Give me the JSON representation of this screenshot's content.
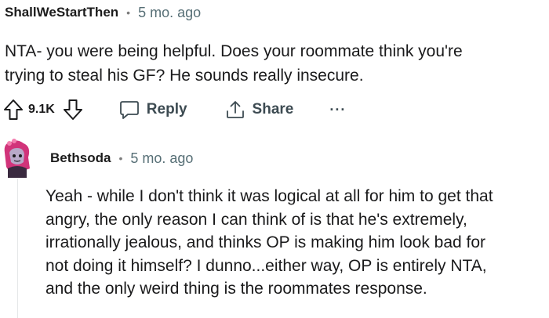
{
  "comment": {
    "username": "ShallWeStartThen",
    "separator": "•",
    "time": "5 mo. ago",
    "body_lines": [
      "NTA- you were being helpful. Does your roommate think you're",
      "trying to steal his GF? He sounds really insecure."
    ],
    "actions": {
      "upvote_icon": "arrow-up-icon",
      "vote_count": "9.1K",
      "downvote_icon": "arrow-down-icon",
      "reply_label": "Reply",
      "share_label": "Share",
      "more_label": "···"
    }
  },
  "reply": {
    "username": "Bethsoda",
    "separator": "•",
    "time": "5 mo. ago",
    "body_lines": [
      "Yeah - while I don't think it was logical at all for him to get that",
      "angry, the only reason I can think of is that he's extremely,",
      "irrationally jealous, and thinks OP is making him look bad for",
      "not doing it himself? I dunno...either way, OP is entirely NTA,",
      "and the only weird thing is the roommates response."
    ]
  },
  "colors": {
    "text": "#1a1a1b",
    "meta": "#576f76",
    "action": "#3d4b52",
    "avatar_accent": "#d1347a"
  }
}
